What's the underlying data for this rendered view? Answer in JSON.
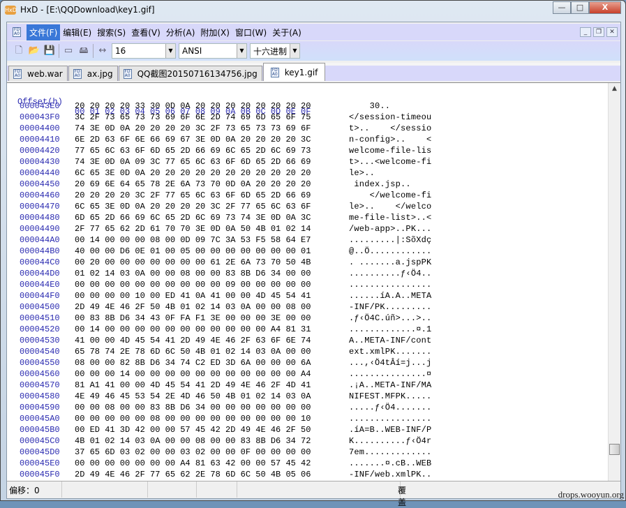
{
  "window": {
    "title": "HxD - [E:\\QQDownload\\key1.gif]",
    "min": "—",
    "max": "□",
    "close": "X"
  },
  "menu": [
    {
      "label": "文件(F)"
    },
    {
      "label": "编辑(E)"
    },
    {
      "label": "搜索(S)"
    },
    {
      "label": "查看(V)"
    },
    {
      "label": "分析(A)"
    },
    {
      "label": "附加(X)"
    },
    {
      "label": "窗口(W)"
    },
    {
      "label": "关于(A)"
    }
  ],
  "toolbar": {
    "bytes_per_row": "16",
    "charset": "ANSI",
    "offset_base": "十六进制"
  },
  "tabs": [
    {
      "label": "web.war"
    },
    {
      "label": "ax.jpg"
    },
    {
      "label": "QQ截图20150716134756.jpg"
    },
    {
      "label": "key1.gif"
    }
  ],
  "hex_header": {
    "offset_label": "Offset(h)",
    "columns": "00 01 02 03 04 05 06 07 08 09 0A 0B 0C 0D 0E 0F"
  },
  "rows": [
    [
      "000043E0",
      "20 20 20 20 33 30 0D 0A 20 20 20 20 20 20 20 20",
      "    30..        "
    ],
    [
      "000043F0",
      "3C 2F 73 65 73 73 69 6F 6E 2D 74 69 6D 65 6F 75",
      "</session-timeou"
    ],
    [
      "00004400",
      "74 3E 0D 0A 20 20 20 20 3C 2F 73 65 73 73 69 6F",
      "t>..    </sessio"
    ],
    [
      "00004410",
      "6E 2D 63 6F 6E 66 69 67 3E 0D 0A 20 20 20 20 3C",
      "n-config>..    <"
    ],
    [
      "00004420",
      "77 65 6C 63 6F 6D 65 2D 66 69 6C 65 2D 6C 69 73",
      "welcome-file-lis"
    ],
    [
      "00004430",
      "74 3E 0D 0A 09 3C 77 65 6C 63 6F 6D 65 2D 66 69",
      "t>...<welcome-fi"
    ],
    [
      "00004440",
      "6C 65 3E 0D 0A 20 20 20 20 20 20 20 20 20 20 20",
      "le>..           "
    ],
    [
      "00004450",
      "20 69 6E 64 65 78 2E 6A 73 70 0D 0A 20 20 20 20",
      " index.jsp..    "
    ],
    [
      "00004460",
      "20 20 20 20 3C 2F 77 65 6C 63 6F 6D 65 2D 66 69",
      "    </welcome-fi"
    ],
    [
      "00004470",
      "6C 65 3E 0D 0A 20 20 20 20 3C 2F 77 65 6C 63 6F",
      "le>..    </welco"
    ],
    [
      "00004480",
      "6D 65 2D 66 69 6C 65 2D 6C 69 73 74 3E 0D 0A 3C",
      "me-file-list>..<"
    ],
    [
      "00004490",
      "2F 77 65 62 2D 61 70 70 3E 0D 0A 50 4B 01 02 14",
      "/web-app>..PK..."
    ],
    [
      "000044A0",
      "00 14 00 00 00 08 00 0D 09 7C 3A 53 F5 58 64 E7",
      ".........|:SõXdç"
    ],
    [
      "000044B0",
      "40 00 00 D6 0E 01 00 05 00 00 00 00 00 00 00 01",
      "@..Ö............"
    ],
    [
      "000044C0",
      "00 20 00 00 00 00 00 00 00 61 2E 6A 73 70 50 4B",
      ". .......a.jspPK"
    ],
    [
      "000044D0",
      "01 02 14 03 0A 00 00 08 00 00 83 8B D6 34 00 00",
      "..........ƒ‹Ö4.."
    ],
    [
      "000044E0",
      "00 00 00 00 00 00 00 00 00 00 09 00 00 00 00 00",
      "................"
    ],
    [
      "000044F0",
      "00 00 00 00 10 00 ED 41 0A 41 00 00 4D 45 54 41",
      "......íA.A..META"
    ],
    [
      "00004500",
      "2D 49 4E 46 2F 50 4B 01 02 14 03 0A 00 00 08 00",
      "-INF/PK........."
    ],
    [
      "00004510",
      "00 83 8B D6 34 43 0F FA F1 3E 00 00 00 3E 00 00",
      ".ƒ‹Ö4C.úñ>...>.."
    ],
    [
      "00004520",
      "00 14 00 00 00 00 00 00 00 00 00 00 00 A4 81 31",
      ".............¤.1"
    ],
    [
      "00004530",
      "41 00 00 4D 45 54 41 2D 49 4E 46 2F 63 6F 6E 74",
      "A..META-INF/cont"
    ],
    [
      "00004540",
      "65 78 74 2E 78 6D 6C 50 4B 01 02 14 03 0A 00 00",
      "ext.xmlPK......."
    ],
    [
      "00004550",
      "08 00 00 82 8B D6 34 74 C2 ED 3D 6A 00 00 00 6A",
      "...,‹Ö4tÂí=j...j"
    ],
    [
      "00004560",
      "00 00 00 14 00 00 00 00 00 00 00 00 00 00 00 A4",
      "...............¤"
    ],
    [
      "00004570",
      "81 A1 41 00 00 4D 45 54 41 2D 49 4E 46 2F 4D 41",
      ".¡A..META-INF/MA"
    ],
    [
      "00004580",
      "4E 49 46 45 53 54 2E 4D 46 50 4B 01 02 14 03 0A",
      "NIFEST.MFPK....."
    ],
    [
      "00004590",
      "00 00 08 00 00 83 8B D6 34 00 00 00 00 00 00 00",
      ".....ƒ‹Ö4......."
    ],
    [
      "000045A0",
      "00 00 00 00 00 08 00 00 00 00 00 00 00 00 00 10",
      "................"
    ],
    [
      "000045B0",
      "00 ED 41 3D 42 00 00 57 45 42 2D 49 4E 46 2F 50",
      ".íA=B..WEB-INF/P"
    ],
    [
      "000045C0",
      "4B 01 02 14 03 0A 00 00 08 00 00 83 8B D6 34 72",
      "K..........ƒ‹Ö4r"
    ],
    [
      "000045D0",
      "37 65 6D 03 02 00 00 03 02 00 00 0F 00 00 00 00",
      "7em............."
    ],
    [
      "000045E0",
      "00 00 00 00 00 00 00 A4 81 63 42 00 00 57 45 42",
      ".......¤.cB..WEB"
    ],
    [
      "000045F0",
      "2D 49 4E 46 2F 77 65 62 2E 78 6D 6C 50 4B 05 06",
      "-INF/web.xmlPK.."
    ]
  ],
  "status": {
    "offset": "偏移：0",
    "mode": "覆盖"
  },
  "watermark": "drops.wooyun.org"
}
